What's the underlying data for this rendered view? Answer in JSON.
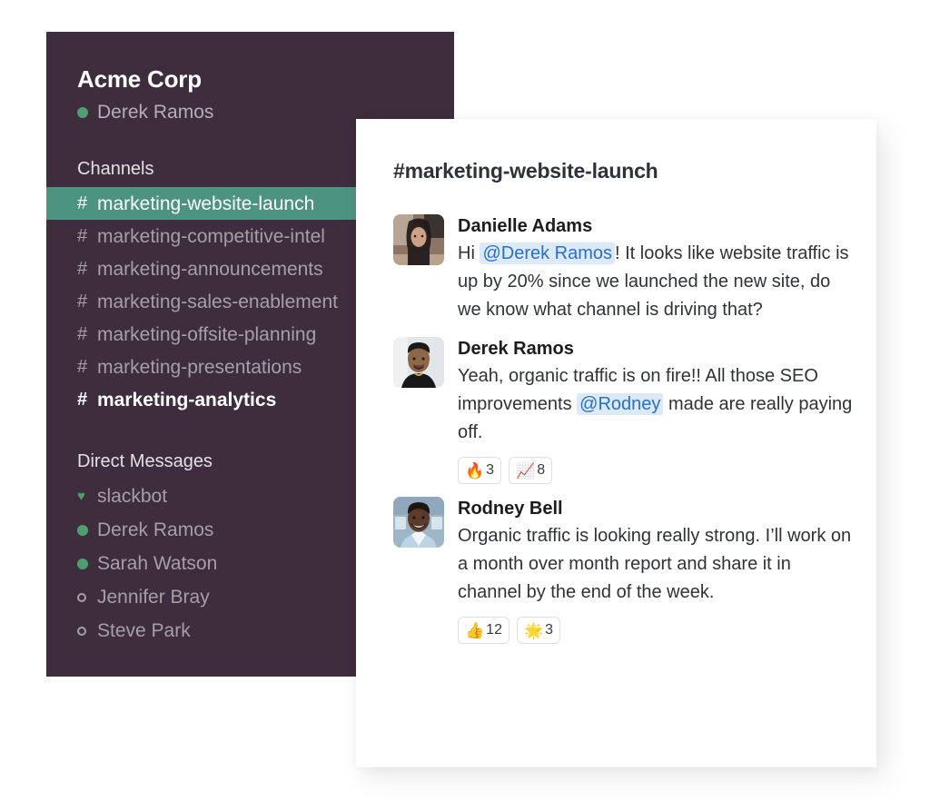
{
  "theme": {
    "sidebar_bg": "#3d2d3d",
    "sidebar_active_bg": "#4d9480",
    "sidebar_text": "#a79fa7",
    "sidebar_heading": "#e4e0e4",
    "panel_bg": "#ffffff",
    "mention_text": "#2a6fc9",
    "mention_bg": "#dce9f7",
    "presence_online": "#4e9e6f",
    "message_text": "#2f3238"
  },
  "sidebar": {
    "workspace_name": "Acme Corp",
    "current_user": {
      "name": "Derek Ramos",
      "presence": "online"
    },
    "channels_header": "Channels",
    "channels": [
      {
        "name": "marketing-website-launch",
        "hash": "#",
        "state": "active"
      },
      {
        "name": "marketing-competitive-intel",
        "hash": "#",
        "state": "read"
      },
      {
        "name": "marketing-announcements",
        "hash": "#",
        "state": "read"
      },
      {
        "name": "marketing-sales-enablement",
        "hash": "#",
        "state": "read"
      },
      {
        "name": "marketing-offsite-planning",
        "hash": "#",
        "state": "read"
      },
      {
        "name": "marketing-presentations",
        "hash": "#",
        "state": "read"
      },
      {
        "name": "marketing-analytics",
        "hash": "#",
        "state": "unread"
      }
    ],
    "dms_header": "Direct Messages",
    "direct_messages": [
      {
        "name": "slackbot",
        "presence": "bot"
      },
      {
        "name": "Derek Ramos",
        "presence": "online"
      },
      {
        "name": "Sarah Watson",
        "presence": "online"
      },
      {
        "name": "Jennifer Bray",
        "presence": "offline"
      },
      {
        "name": "Steve Park",
        "presence": "offline"
      }
    ]
  },
  "panel": {
    "channel_title": "#marketing-website-launch",
    "messages": [
      {
        "author": "Danielle Adams",
        "avatar_name": "avatar-danielle-adams",
        "segments": [
          {
            "type": "text",
            "value": "Hi "
          },
          {
            "type": "mention",
            "value": "@Derek Ramos"
          },
          {
            "type": "text",
            "value": "! It looks like website traffic is up by 20% since we launched the new site, do we know what channel is driving that?"
          }
        ],
        "reactions": []
      },
      {
        "author": "Derek Ramos",
        "avatar_name": "avatar-derek-ramos",
        "segments": [
          {
            "type": "text",
            "value": "Yeah, organic traffic is on fire!! All those SEO improvements "
          },
          {
            "type": "mention",
            "value": "@Rodney"
          },
          {
            "type": "text",
            "value": " made are really paying off."
          }
        ],
        "reactions": [
          {
            "emoji": "🔥",
            "emoji_name": "fire-emoji",
            "count": "3"
          },
          {
            "emoji": "📈",
            "emoji_name": "chart-increasing-emoji",
            "count": "8"
          }
        ]
      },
      {
        "author": "Rodney Bell",
        "avatar_name": "avatar-rodney-bell",
        "segments": [
          {
            "type": "text",
            "value": "Organic traffic is looking really strong. I’ll work on a month over month report and share it in channel by the end of the week."
          }
        ],
        "reactions": [
          {
            "emoji": "👍",
            "emoji_name": "thumbs-up-emoji",
            "count": "12"
          },
          {
            "emoji": "🌟",
            "emoji_name": "glowing-star-emoji",
            "count": "3"
          }
        ]
      }
    ]
  }
}
